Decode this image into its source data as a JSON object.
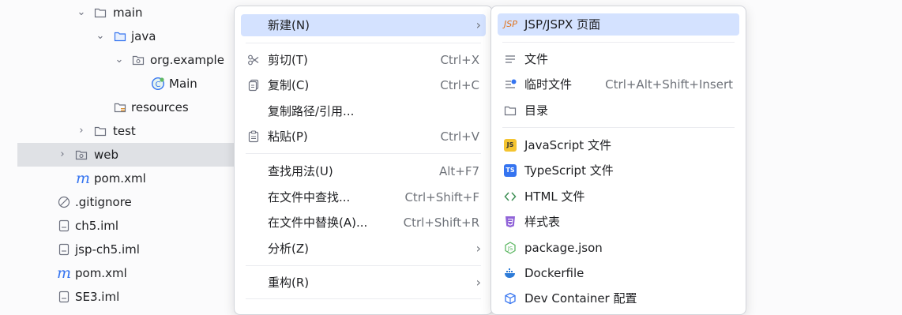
{
  "project_tree": {
    "items": [
      {
        "label": "main"
      },
      {
        "label": "java"
      },
      {
        "label": "org.example"
      },
      {
        "label": "Main"
      },
      {
        "label": "resources"
      },
      {
        "label": "test"
      },
      {
        "label": "web"
      },
      {
        "label": "pom.xml"
      },
      {
        "label": ".gitignore"
      },
      {
        "label": "ch5.iml"
      },
      {
        "label": "jsp-ch5.iml"
      },
      {
        "label": "pom.xml"
      },
      {
        "label": "SE3.iml"
      }
    ]
  },
  "context_menu": {
    "items": [
      {
        "label": "新建(N)",
        "shortcut": ""
      },
      {
        "label": "剪切(T)",
        "shortcut": "Ctrl+X"
      },
      {
        "label": "复制(C)",
        "shortcut": "Ctrl+C"
      },
      {
        "label": "复制路径/引用...",
        "shortcut": ""
      },
      {
        "label": "粘贴(P)",
        "shortcut": "Ctrl+V"
      },
      {
        "label": "查找用法(U)",
        "shortcut": "Alt+F7"
      },
      {
        "label": "在文件中查找...",
        "shortcut": "Ctrl+Shift+F"
      },
      {
        "label": "在文件中替换(A)...",
        "shortcut": "Ctrl+Shift+R"
      },
      {
        "label": "分析(Z)",
        "shortcut": ""
      },
      {
        "label": "重构(R)",
        "shortcut": ""
      }
    ]
  },
  "new_submenu": {
    "items": [
      {
        "label": "JSP/JSPX 页面",
        "shortcut": ""
      },
      {
        "label": "文件",
        "shortcut": ""
      },
      {
        "label": "临时文件",
        "shortcut": "Ctrl+Alt+Shift+Insert"
      },
      {
        "label": "目录",
        "shortcut": ""
      },
      {
        "label": "JavaScript 文件",
        "shortcut": ""
      },
      {
        "label": "TypeScript 文件",
        "shortcut": ""
      },
      {
        "label": "HTML 文件",
        "shortcut": ""
      },
      {
        "label": "样式表",
        "shortcut": ""
      },
      {
        "label": "package.json",
        "shortcut": ""
      },
      {
        "label": "Dockerfile",
        "shortcut": ""
      },
      {
        "label": "Dev Container 配置",
        "shortcut": ""
      }
    ],
    "icon_text": {
      "jsp": "JSP",
      "js": "JS",
      "ts": "TS"
    }
  },
  "colors": {
    "highlight": "#d4e2ff",
    "selected_row": "#dfe1e5",
    "folder": "#6c707e",
    "maven": "#3574f0"
  }
}
